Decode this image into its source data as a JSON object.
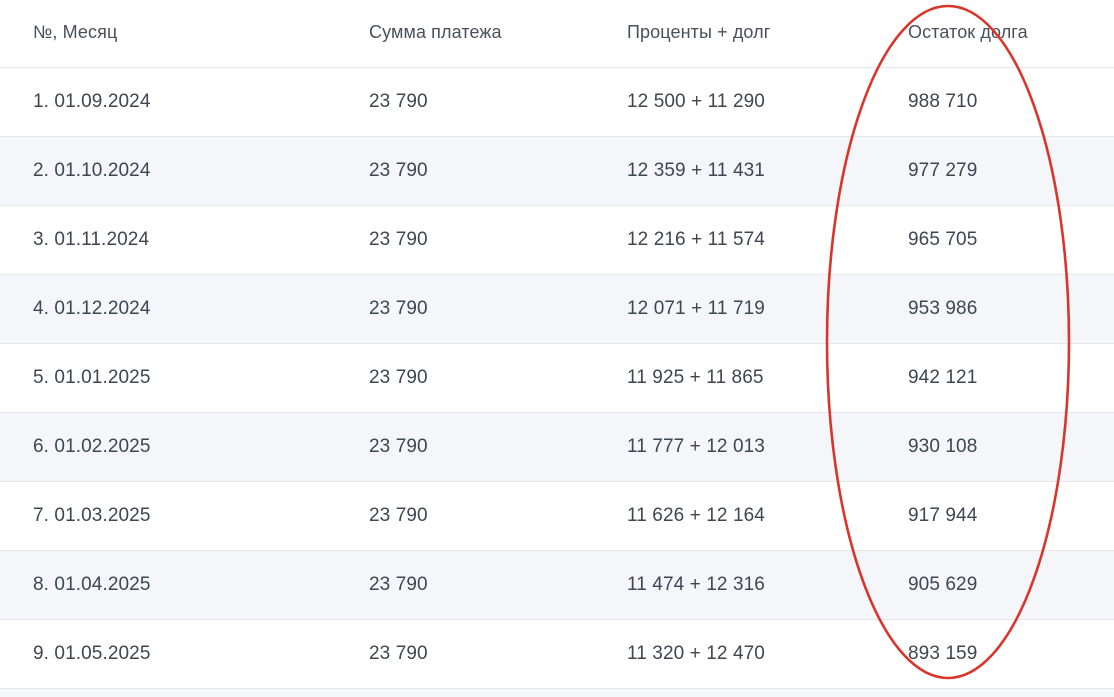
{
  "table": {
    "headers": [
      "№, Месяц",
      "Сумма платежа",
      "Проценты + долг",
      "Остаток долга"
    ],
    "rows": [
      [
        "1. 01.09.2024",
        "23 790",
        "12 500 + 11 290",
        "988 710"
      ],
      [
        "2. 01.10.2024",
        "23 790",
        "12 359 + 11 431",
        "977 279"
      ],
      [
        "3. 01.11.2024",
        "23 790",
        "12 216 + 11 574",
        "965 705"
      ],
      [
        "4. 01.12.2024",
        "23 790",
        "12 071 + 11 719",
        "953 986"
      ],
      [
        "5. 01.01.2025",
        "23 790",
        "11 925 + 11 865",
        "942 121"
      ],
      [
        "6. 01.02.2025",
        "23 790",
        "11 777 + 12 013",
        "930 108"
      ],
      [
        "7. 01.03.2025",
        "23 790",
        "11 626 + 12 164",
        "917 944"
      ],
      [
        "8. 01.04.2025",
        "23 790",
        "11 474 + 12 316",
        "905 629"
      ],
      [
        "9. 01.05.2025",
        "23 790",
        "11 320 + 12 470",
        "893 159"
      ]
    ]
  },
  "colors": {
    "text": "#3f4650",
    "alt_row": "#f4f6f9",
    "divider": "#e3e7ec",
    "annotation": "#d9352b"
  },
  "annotation": {
    "shape": "ellipse",
    "highlights_column": "Остаток долга"
  }
}
